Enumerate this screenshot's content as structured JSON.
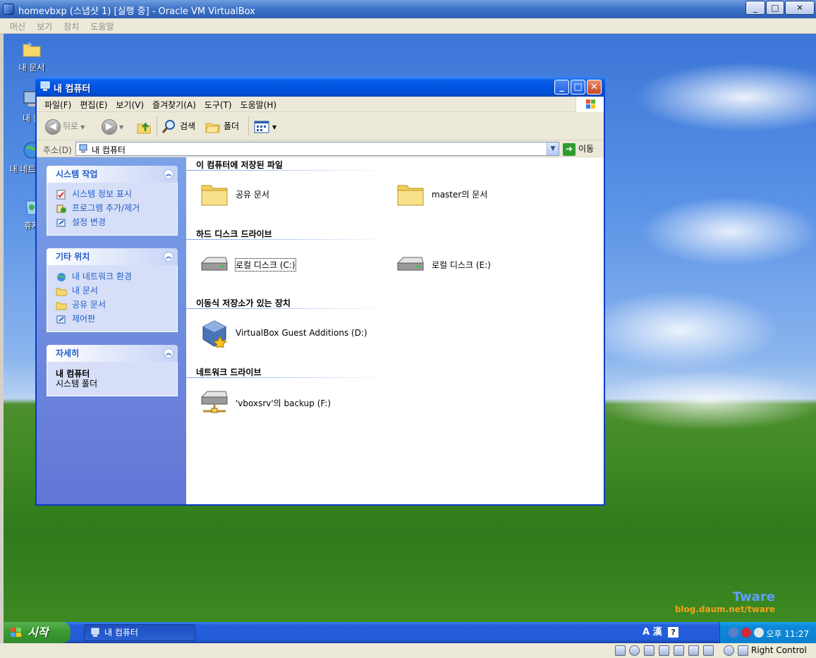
{
  "host": {
    "title": "homevbxp (스냅샷 1) [실행 중] - Oracle VM VirtualBox",
    "menu": [
      "머신",
      "보기",
      "장치",
      "도움말"
    ],
    "status_right": "Right Control"
  },
  "desktop": {
    "icons": [
      {
        "label": "내 문서",
        "icon": "my-documents-icon"
      },
      {
        "label": "내 컴",
        "icon": "my-computer-icon"
      },
      {
        "label": "내 네트 환경",
        "icon": "network-places-icon"
      },
      {
        "label": "휴지",
        "icon": "recycle-bin-icon"
      }
    ],
    "watermark_title": "Tware",
    "watermark_url": "blog.daum.net/tware"
  },
  "explorer": {
    "title": "내 컴퓨터",
    "menu": [
      "파일(F)",
      "편집(E)",
      "보기(V)",
      "즐겨찾기(A)",
      "도구(T)",
      "도움말(H)"
    ],
    "toolbar": {
      "back": "뒤로",
      "search": "검색",
      "folders": "폴더"
    },
    "address": {
      "label": "주소(D)",
      "value": "내 컴퓨터",
      "go": "이동"
    },
    "taskpane": {
      "system_tasks": {
        "title": "시스템 작업",
        "items": [
          "시스템 정보 표시",
          "프로그램 추가/제거",
          "설정 변경"
        ]
      },
      "other_places": {
        "title": "기타 위치",
        "items": [
          "내 네트워크 환경",
          "내 문서",
          "공유 문서",
          "제어판"
        ]
      },
      "details": {
        "title": "자세히",
        "name": "내 컴퓨터",
        "type": "시스템 폴더"
      }
    },
    "groups": [
      {
        "title": "이 컴퓨터에 저장된 파일",
        "items": [
          "공유 문서",
          "master의 문서"
        ]
      },
      {
        "title": "하드 디스크 드라이브",
        "items": [
          "로컬 디스크 (C:)",
          "로컬 디스크 (E:)"
        ]
      },
      {
        "title": "이동식 저장소가 있는 장치",
        "items": [
          "VirtualBox Guest Additions (D:)"
        ]
      },
      {
        "title": "네트워크 드라이브",
        "items": [
          "'vboxsrv'의 backup (F:)"
        ]
      }
    ]
  },
  "taskbar": {
    "start": "시작",
    "task": "내 컴퓨터",
    "lang": "A 漢",
    "help": "?",
    "clock": "오후 11:27"
  },
  "colors": {
    "xp_blue": "#0054e3",
    "taskpane_link": "#215dc6",
    "start_green": "#3c9c33"
  }
}
